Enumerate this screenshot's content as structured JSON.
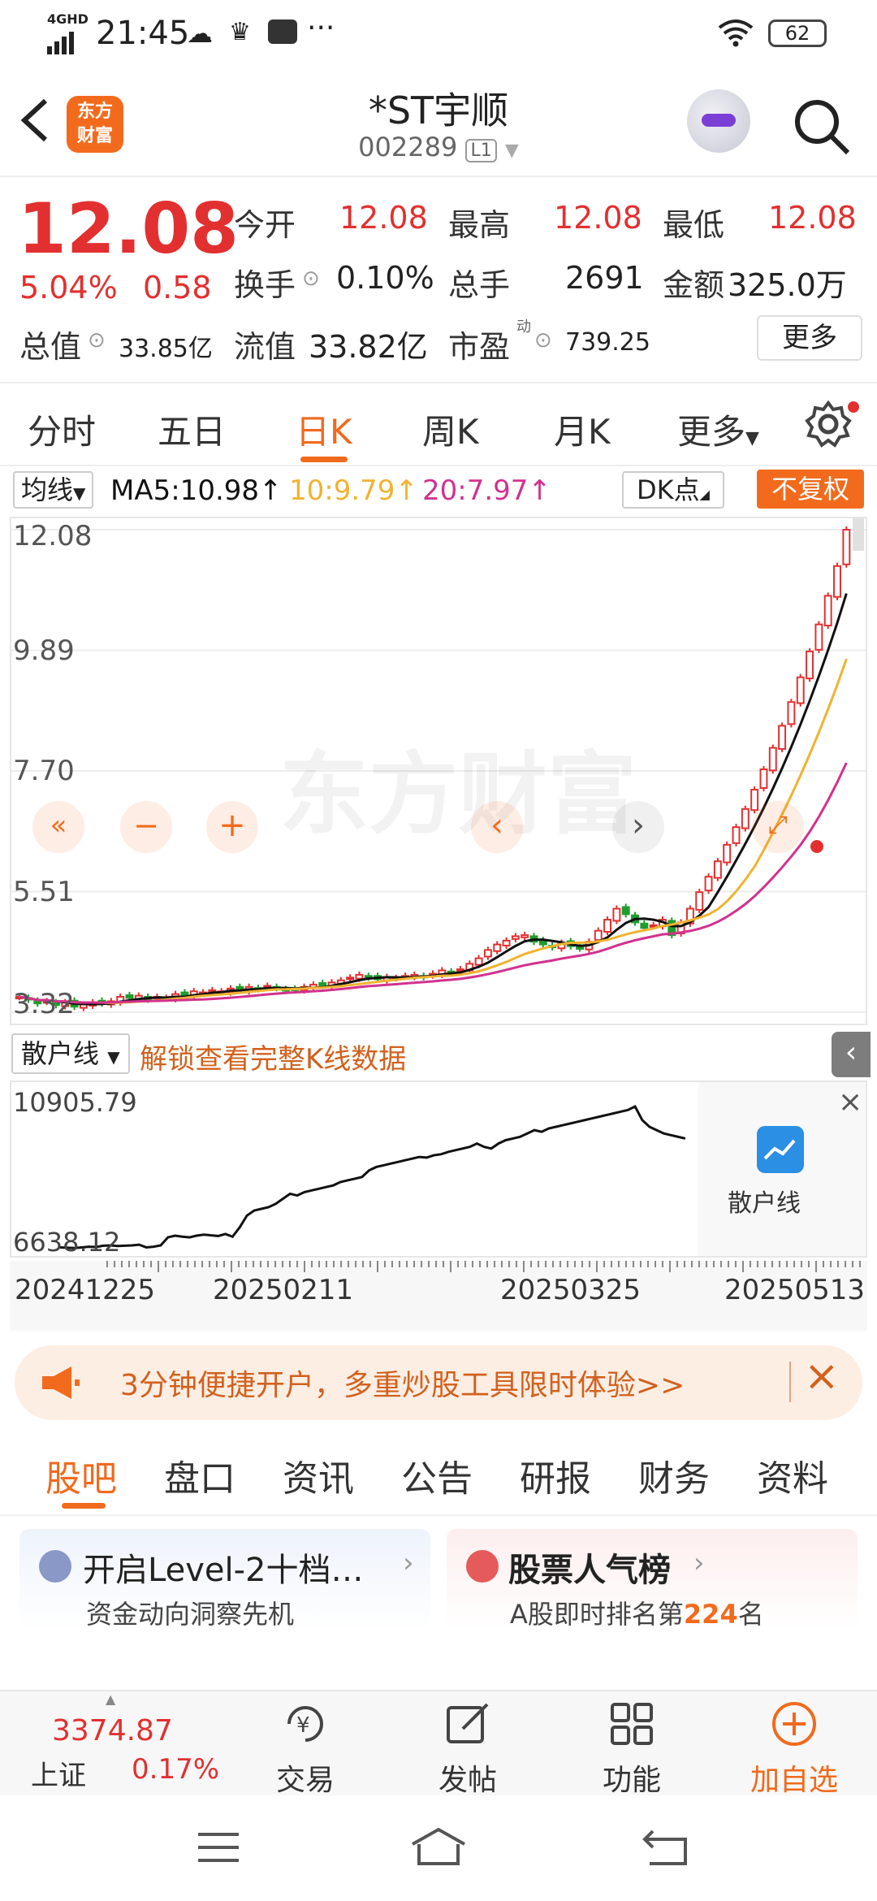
{
  "status_bar": {
    "network": "4GHD",
    "time": "21:45",
    "battery": "62",
    "more": "···"
  },
  "header": {
    "title": "*ST宇顺",
    "code": "002289",
    "level": "L1",
    "logo_line1": "东方",
    "logo_line2": "财富"
  },
  "quote": {
    "price": "12.08",
    "change_pct": "5.04%",
    "change_amt": "0.58",
    "open_label": "今开",
    "open": "12.08",
    "high_label": "最高",
    "high": "12.08",
    "low_label": "最低",
    "low": "12.08",
    "turnover_label": "换手",
    "turnover": "0.10%",
    "volume_label": "总手",
    "volume": "2691",
    "amount_label": "金额",
    "amount": "325.0万",
    "mktcap_label": "总值",
    "mktcap": "33.85亿",
    "float_label": "流值",
    "float_cap": "33.82亿",
    "pe_label": "市盈",
    "pe_sup": "动",
    "pe": "739.25",
    "more": "更多"
  },
  "ktabs": [
    "分时",
    "五日",
    "日K",
    "周K",
    "月K",
    "更多"
  ],
  "ma_bar": {
    "selector": "均线",
    "ma5": "MA5:10.98↑",
    "ma10": "10:9.79↑",
    "ma20": "20:7.97↑",
    "dk": "DK点",
    "adjust": "不复权"
  },
  "chart_data": {
    "type": "candlestick",
    "y_ticks": [
      "12.08",
      "9.89",
      "7.70",
      "5.51",
      "3.32"
    ],
    "ylim": [
      3.32,
      12.08
    ],
    "watermark": "东方财富",
    "colors": {
      "up": "#e23030",
      "down": "#1f9d2e",
      "ma5": "#111111",
      "ma10": "#f0b330",
      "ma20": "#d2318f"
    },
    "closes": [
      3.6,
      3.55,
      3.48,
      3.52,
      3.45,
      3.5,
      3.42,
      3.46,
      3.5,
      3.48,
      3.52,
      3.6,
      3.58,
      3.62,
      3.55,
      3.6,
      3.58,
      3.65,
      3.62,
      3.7,
      3.68,
      3.72,
      3.7,
      3.75,
      3.72,
      3.78,
      3.74,
      3.8,
      3.76,
      3.72,
      3.74,
      3.78,
      3.82,
      3.8,
      3.86,
      3.9,
      3.95,
      4.0,
      3.95,
      3.92,
      3.96,
      3.94,
      3.98,
      4.0,
      3.96,
      4.02,
      4.08,
      4.05,
      4.1,
      4.2,
      4.3,
      4.45,
      4.55,
      4.62,
      4.7,
      4.72,
      4.6,
      4.55,
      4.5,
      4.58,
      4.52,
      4.48,
      4.6,
      4.8,
      5.0,
      5.2,
      5.1,
      4.95,
      4.85,
      4.9,
      5.0,
      4.72,
      4.95,
      5.2,
      5.5,
      5.78,
      6.06,
      6.36,
      6.68,
      7.01,
      7.36,
      7.73,
      8.12,
      8.52,
      8.95,
      9.4,
      9.87,
      10.36,
      10.88,
      11.42,
      12.08
    ],
    "sub_title": "散户线",
    "sub_ticks": [
      "10905.79",
      "6638.12"
    ],
    "sub_ylim": [
      6638.12,
      10905.79
    ],
    "sub_values": [
      6700,
      6690,
      6680,
      6700,
      6720,
      6710,
      6750,
      6760,
      6740,
      6750,
      6760,
      6780,
      6700,
      6720,
      6760,
      7000,
      7050,
      7020,
      7000,
      7050,
      7080,
      7060,
      7040,
      7100,
      7020,
      7300,
      7650,
      7800,
      7850,
      7900,
      8000,
      8150,
      8300,
      8250,
      8350,
      8400,
      8450,
      8500,
      8550,
      8650,
      8700,
      8750,
      8800,
      9000,
      9100,
      9150,
      9200,
      9250,
      9300,
      9350,
      9400,
      9380,
      9450,
      9480,
      9550,
      9600,
      9650,
      9700,
      9800,
      9700,
      9650,
      9800,
      9900,
      9950,
      10000,
      10100,
      10200,
      10150,
      10250,
      10300,
      10350,
      10400,
      10450,
      10500,
      10550,
      10600,
      10650,
      10700,
      10750,
      10800,
      10905.79,
      10500,
      10300,
      10200,
      10100,
      10050,
      10000,
      9950
    ],
    "x_ticks": [
      "20241225",
      "20250211",
      "20250325",
      "20250513"
    ]
  },
  "sub_bar": {
    "selector": "散户线",
    "unlock": "解锁查看完整K线数据"
  },
  "sub_panel": {
    "label": "散户线"
  },
  "banner": {
    "text": "3分钟便捷开户，多重炒股工具限时体验>>"
  },
  "btabs": [
    "股吧",
    "盘口",
    "资讯",
    "公告",
    "研报",
    "财务",
    "资料"
  ],
  "cards": {
    "left_title": "开启Level-2十档…",
    "left_sub": "资金动向洞察先机",
    "right_title": "股票人气榜",
    "right_sub_pre": "A股即时排名第",
    "right_rank": "224",
    "right_sub_post": "名"
  },
  "bottom": {
    "index_value": "3374.87",
    "index_name": "上证",
    "index_change": "0.17%",
    "trade": "交易",
    "post": "发帖",
    "func": "功能",
    "add": "加自选"
  }
}
